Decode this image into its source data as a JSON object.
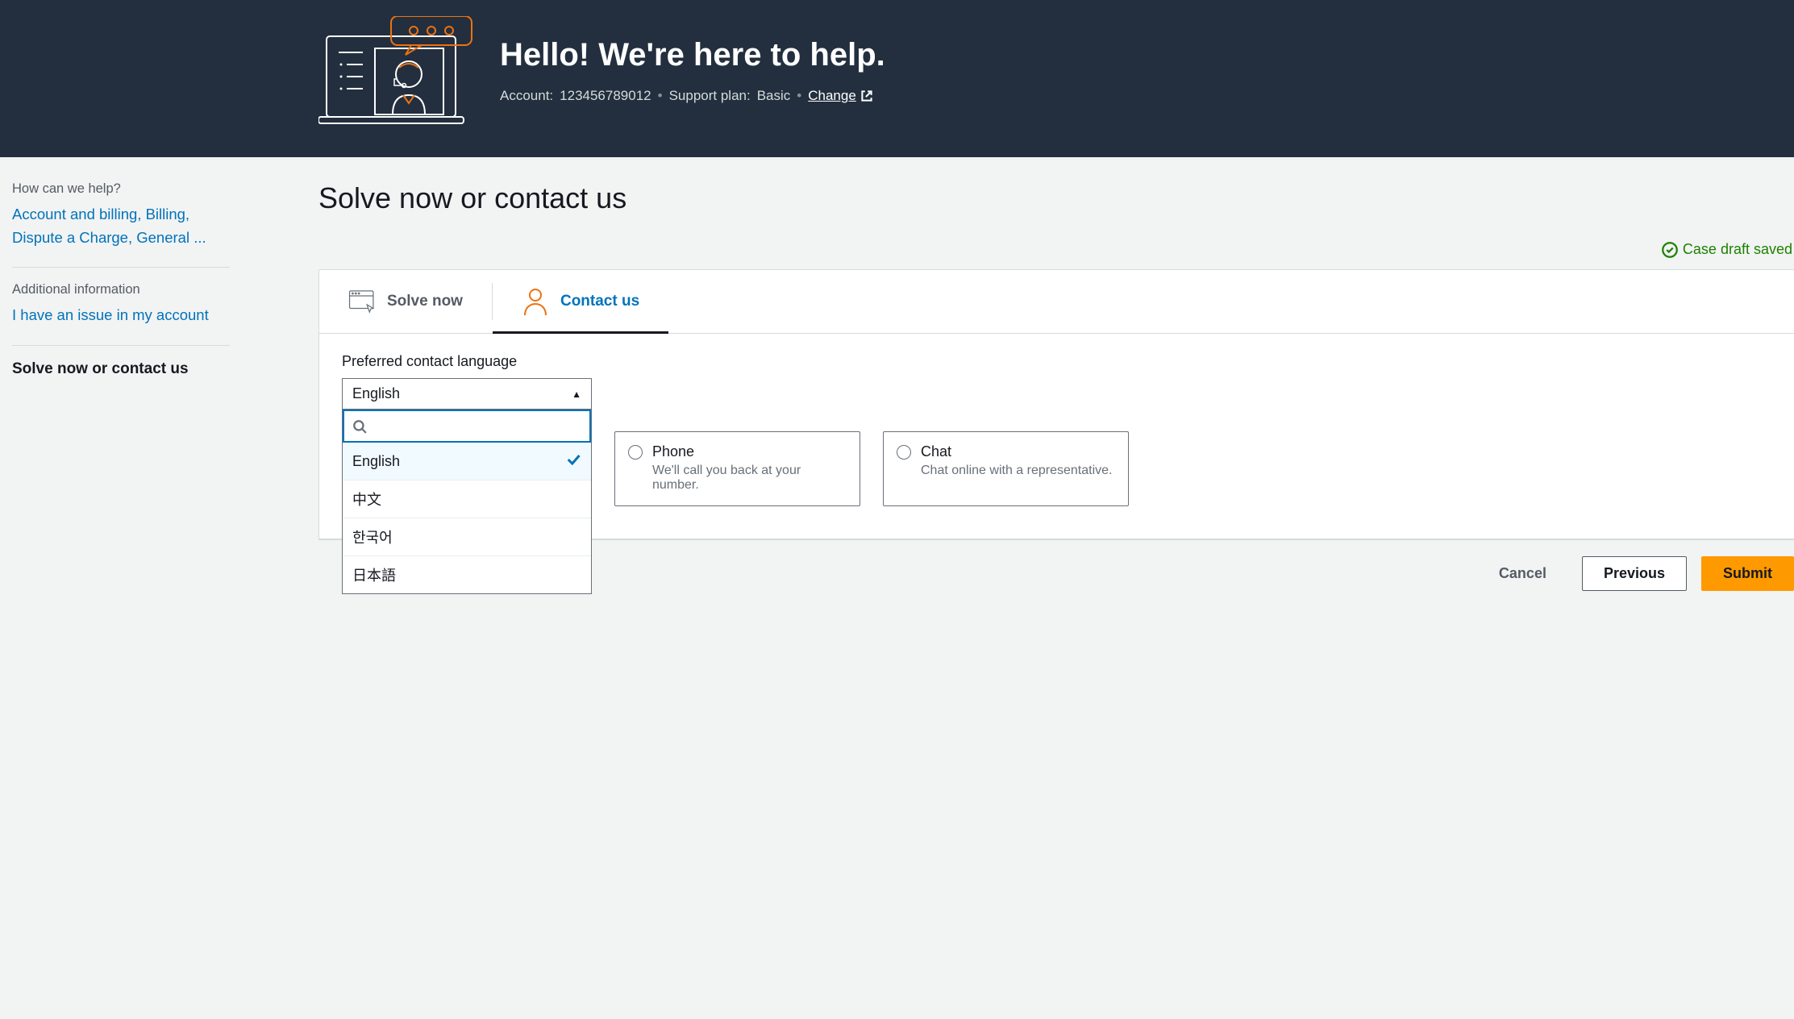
{
  "header": {
    "title": "Hello!  We're here to help.",
    "account_label": "Account:",
    "account_id": "123456789012",
    "plan_label": "Support plan:",
    "plan_value": "Basic",
    "change_label": "Change"
  },
  "sidebar": {
    "help_label": "How can we help?",
    "help_link": "Account and billing, Billing, Dispute a Charge, General ...",
    "additional_label": "Additional information",
    "additional_link": "I have an issue in my account",
    "current_step": "Solve now or contact us"
  },
  "main": {
    "title": "Solve now or contact us",
    "draft_saved": "Case draft saved"
  },
  "tabs": {
    "solve_now": "Solve now",
    "contact_us": "Contact us"
  },
  "language_select": {
    "label": "Preferred contact language",
    "selected": "English",
    "search_value": "",
    "options": [
      "English",
      "中文",
      "한국어",
      "日本語"
    ]
  },
  "contact_options": {
    "phone": {
      "title": "Phone",
      "desc": "We'll call you back at your number."
    },
    "chat": {
      "title": "Chat",
      "desc": "Chat online with a representative."
    }
  },
  "buttons": {
    "cancel": "Cancel",
    "previous": "Previous",
    "submit": "Submit"
  }
}
